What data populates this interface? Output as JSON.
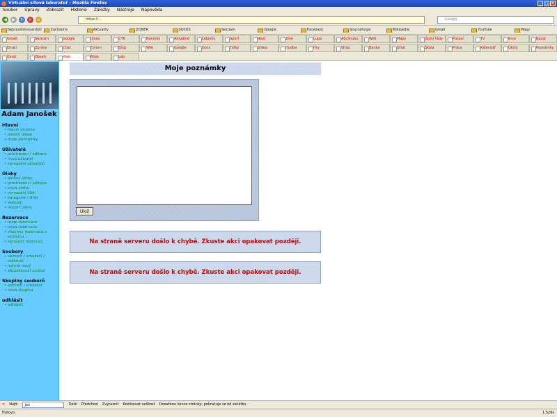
{
  "browser": {
    "title": "Virtuální síťová laboratoř - Mozilla Firefox",
    "menu": [
      "Soubor",
      "Úpravy",
      "Zobrazit",
      "Historie",
      "Záložky",
      "Nástroje",
      "Nápověda"
    ],
    "url": "https://...",
    "search_placeholder": "Google",
    "bookmarks": [
      "Nejnavštěvovanější",
      "Začínáme",
      "Aktuality",
      "ZONER",
      "SOCKS",
      "Seznam",
      "Google",
      "Facebook",
      "Sourceforge",
      "Wikipedie",
      "Gmail",
      "YouTube",
      "Mapy"
    ],
    "tabs_row1": [
      "Gmail",
      "Seznam",
      "Google",
      "Idnes",
      "CTK",
      "Novinky",
      "Aktuálně",
      "Lidovky",
      "Sport",
      "Root",
      "Zive",
      "Lupa",
      "Abclinuxu",
      "Wiki",
      "Mapy",
      "Jízdní řády",
      "Počasí",
      "TV",
      "Kino",
      "Bazar"
    ],
    "tabs_row2": [
      "Email",
      "Zprávy",
      "Chat",
      "Forum",
      "Blog",
      "Wiki",
      "Google",
      "Docs",
      "Fotky",
      "Videa",
      "Hudba",
      "Hry",
      "Shop",
      "Banka",
      "Úřad",
      "Škola",
      "Práce",
      "Kalendář",
      "Úkoly",
      "Poznámky"
    ],
    "tabs_row3": [
      "Úvod",
      "Obsah",
      "Vlab",
      "Moje",
      "Lab"
    ],
    "find_label": "Najít:",
    "find_value": "jan",
    "find_next": "Další",
    "find_prev": "Předchozí",
    "find_highlight": "Zvýraznit",
    "find_matchcase": "Rozlišovat velikost",
    "find_status": "Dosaženo konce stránky, pokračuje se od začátku",
    "status_text": "Hotovo",
    "status_right": "1.526s"
  },
  "sidebar": {
    "name": "Adam Janošek",
    "sections": [
      {
        "title": "Hlavní",
        "items": [
          "hlavní stránka",
          "osobní údaje",
          "moje poznámky"
        ]
      },
      {
        "title": "Uživatelé",
        "items": [
          "procházení / editace",
          "nový uživatel",
          "vymazání uživatelů"
        ]
      },
      {
        "title": "Úlohy",
        "items": [
          "aktivní úlohy",
          "procházení / editace",
          "nová úloha",
          "vymazání úloh",
          "kategorie / třídy",
          "seznam",
          "import úlohy"
        ]
      },
      {
        "title": "Rezervace",
        "items": [
          "moje rezervace",
          "nová rezervace",
          "všechny rezervace v systému",
          "vymazat rezervaci"
        ]
      },
      {
        "title": "Soubory",
        "items": [
          "seznam / smazání / stáhnutí",
          "nahrát nový",
          "aktualizovat soubor"
        ]
      },
      {
        "title": "Skupiny souborů",
        "items": [
          "seznam / smazání",
          "nová skupina"
        ]
      },
      {
        "title": "odhlásit",
        "items": [
          "odhlásit"
        ]
      }
    ]
  },
  "main": {
    "notes_title": "Moje poznámky",
    "notes_value": "",
    "save_button": "Ulož",
    "error1": "Na straně serveru došlo k chybě. Zkuste akci opakovat později.",
    "error2": "Na straně serveru došlo k chybě. Zkuste akci opakovat později."
  }
}
